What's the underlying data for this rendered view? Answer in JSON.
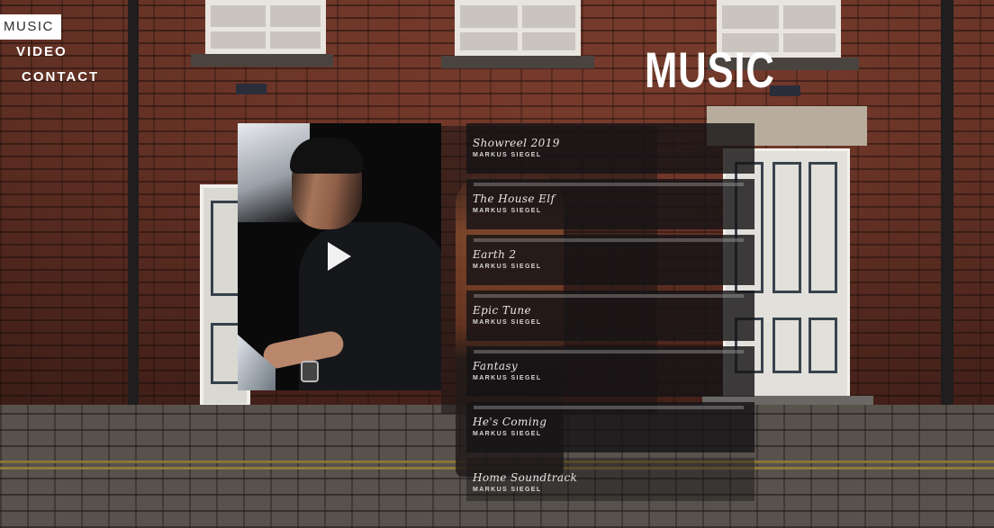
{
  "nav": {
    "items": [
      {
        "label": "MUSIC",
        "active": true
      },
      {
        "label": "VIDEO",
        "active": false
      },
      {
        "label": "CONTACT",
        "active": false
      }
    ]
  },
  "page": {
    "title": "MUSIC"
  },
  "player": {
    "play_icon": "play-icon"
  },
  "tracks": [
    {
      "title": "Showreel 2019",
      "artist": "MARKUS SIEGEL"
    },
    {
      "title": "The House Elf",
      "artist": "MARKUS SIEGEL"
    },
    {
      "title": "Earth 2",
      "artist": "MARKUS SIEGEL"
    },
    {
      "title": "Epic Tune",
      "artist": "MARKUS SIEGEL"
    },
    {
      "title": "Fantasy",
      "artist": "MARKUS SIEGEL"
    },
    {
      "title": "He's Coming",
      "artist": "MARKUS SIEGEL"
    },
    {
      "title": "Home Soundtrack",
      "artist": "MARKUS SIEGEL"
    }
  ],
  "colors": {
    "text": "#ffffff",
    "track_bg": "#161416",
    "nav_active_bg": "#ffffff",
    "nav_active_text": "#2a2a2a"
  }
}
